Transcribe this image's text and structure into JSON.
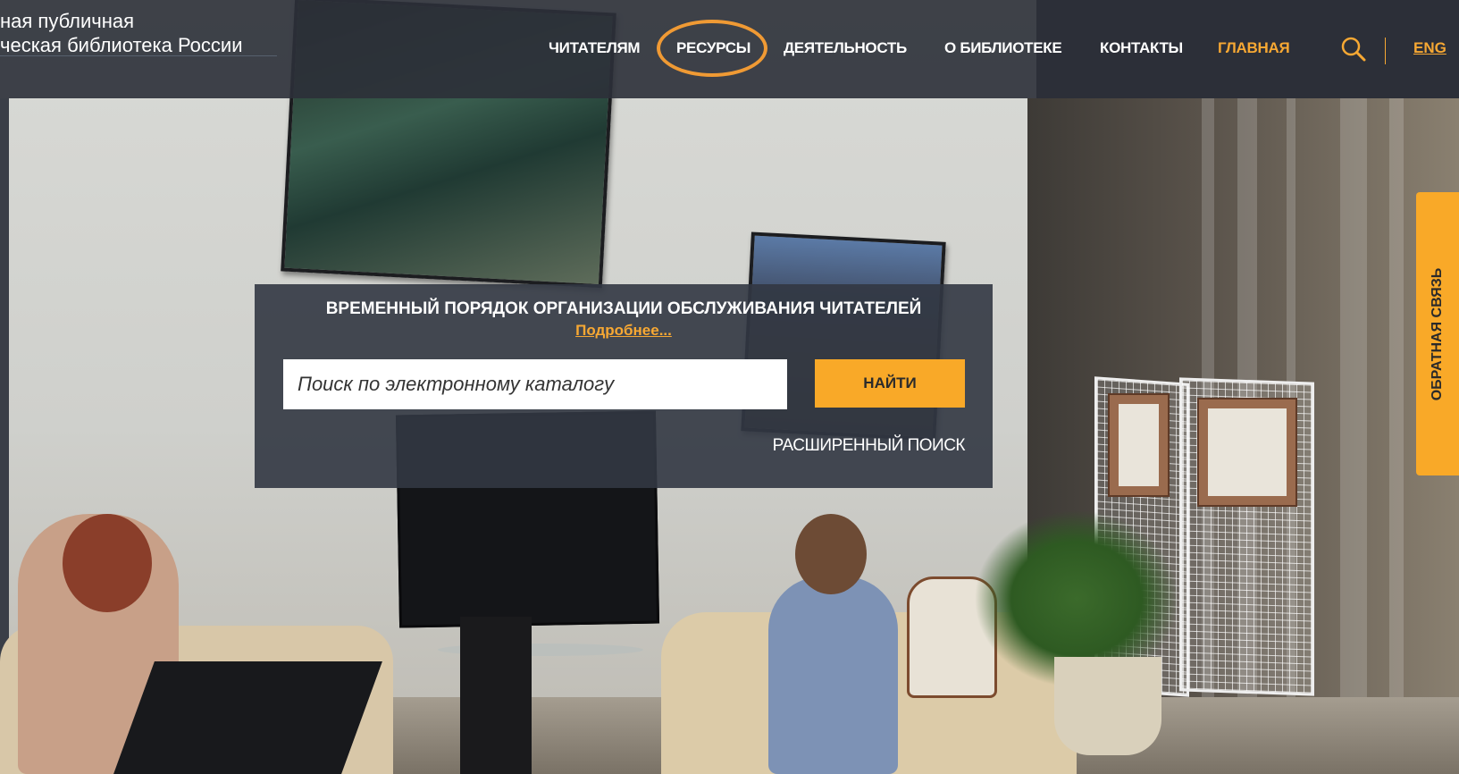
{
  "header": {
    "logo_line1": "ная публичная",
    "logo_line2": "ческая библиотека России",
    "nav": [
      {
        "label": "ЧИТАТЕЛЯМ"
      },
      {
        "label": "РЕСУРСЫ"
      },
      {
        "label": "ДЕЯТЕЛЬНОСТЬ"
      },
      {
        "label": "О БИБЛИОТЕКЕ"
      },
      {
        "label": "КОНТАКТЫ"
      },
      {
        "label": "ГЛАВНАЯ",
        "active": true
      }
    ],
    "search_icon": "search-icon",
    "lang": "ENG"
  },
  "panel": {
    "notice": "ВРЕМЕННЫЙ ПОРЯДОК ОРГАНИЗАЦИИ ОБСЛУЖИВАНИЯ ЧИТАТЕЛЕЙ",
    "more_link": "Подробнее...",
    "search_placeholder": "Поиск по электронному каталогу",
    "find_label": "НАЙТИ",
    "advanced_label": "РАСШИРЕННЫЙ ПОИСК"
  },
  "feedback": {
    "label": "ОБРАТНАЯ СВЯЗЬ"
  },
  "colors": {
    "accent": "#f9a928",
    "header_bg": "#2c3039",
    "highlight_ring": "#f09a34"
  }
}
